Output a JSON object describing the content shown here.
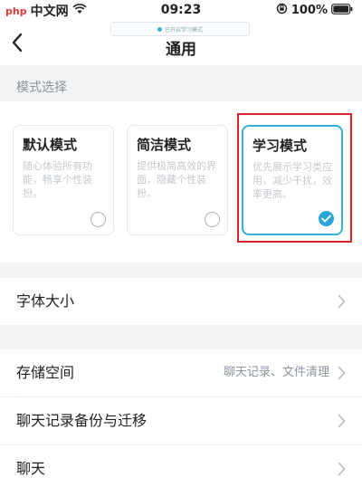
{
  "status_bar": {
    "logo": "php",
    "carrier": "中文网",
    "time": "09:23",
    "battery": "100%"
  },
  "nav": {
    "title": "通用",
    "hint": "已开启学习模式"
  },
  "section": {
    "label": "模式选择"
  },
  "modes": [
    {
      "title": "默认模式",
      "desc": "随心体验所有功能，畅享个性装扮。",
      "selected": false
    },
    {
      "title": "简洁模式",
      "desc": "提供极简高效的界面，隐藏个性装扮。",
      "selected": false
    },
    {
      "title": "学习模式",
      "desc": "优先展示学习类应用，减少干扰，效率更高。",
      "selected": true
    }
  ],
  "settings": {
    "font_size": {
      "label": "字体大小"
    },
    "storage": {
      "label": "存储空间",
      "value": "聊天记录、文件清理"
    },
    "backup": {
      "label": "聊天记录备份与迁移"
    },
    "chat": {
      "label": "聊天"
    }
  },
  "colors": {
    "accent": "#35b3d6",
    "highlight": "#d9232c",
    "background": "#f2f3f5"
  }
}
